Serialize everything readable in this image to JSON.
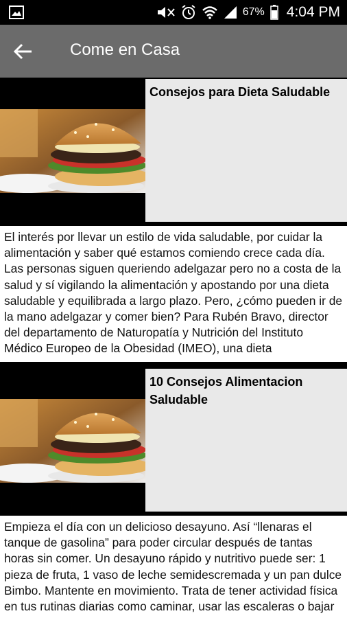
{
  "status_bar": {
    "battery_percent": "67%",
    "time": "4:04 PM",
    "icons": [
      "gallery-icon",
      "mute-icon",
      "alarm-icon",
      "wifi-icon",
      "signal-icon",
      "battery-icon"
    ]
  },
  "app_bar": {
    "title": "Come en Casa",
    "back_icon": "arrow-left-icon"
  },
  "articles": [
    {
      "title": "Consejos para Dieta Saludable",
      "image": "burger-photo",
      "body": "El interés por llevar un estilo de vida saludable, por cuidar la alimentación y saber qué estamos comiendo crece cada día. Las personas siguen queriendo adelgazar pero no a costa de la salud y sí vigilando la alimentación y apostando por una dieta saludable y equilibrada a largo plazo. Pero, ¿cómo pueden ir de la mano adelgazar y comer bien? Para Rubén Bravo, director del departamento de Naturopatía y Nutrición del Instituto Médico Europeo de la Obesidad (IMEO), una dieta"
    },
    {
      "title": "10 Consejos Alimentacion Saludable",
      "image": "burger-photo",
      "body": "Empieza el día con un delicioso desayuno. Así “llenaras el tanque de gasolina” para poder circular después de tantas horas sin comer. Un desayuno rápido y nutritivo puede ser: 1 pieza de fruta, 1 vaso de leche semidescremada y un pan dulce Bimbo. Mantente en movimiento. Trata de tener actividad física en tus rutinas diarias como caminar, usar las escaleras o bajar"
    }
  ],
  "colors": {
    "status_bar": "#000000",
    "app_bar": "#6b6b6b",
    "title_panel": "#e9e9e9",
    "body_bg": "#ffffff"
  }
}
